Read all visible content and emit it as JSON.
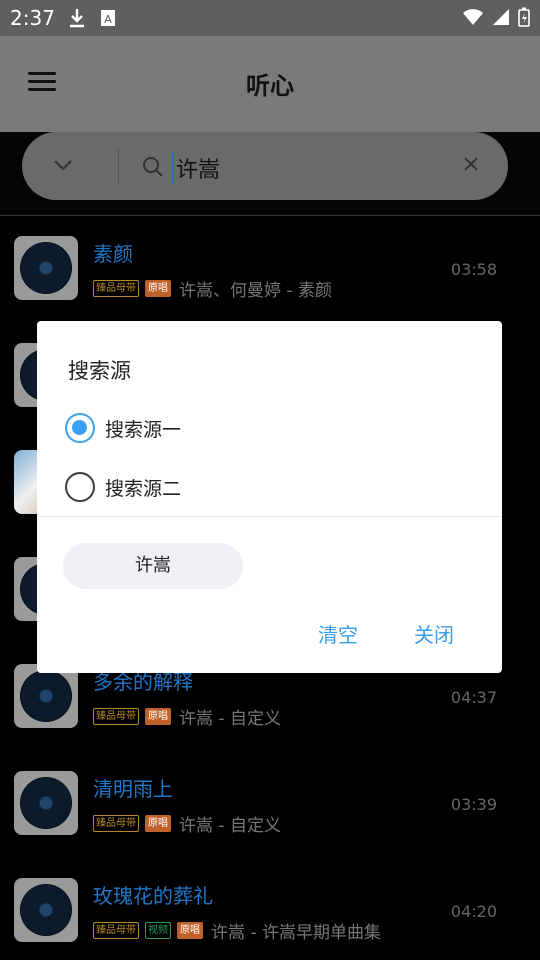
{
  "status_bar": {
    "time": "2:37"
  },
  "app_bar": {
    "title": "听心"
  },
  "search": {
    "query": "许嵩"
  },
  "songs": [
    {
      "title": "素颜",
      "tags": [
        "臻品母带",
        "原唱"
      ],
      "artist": "许嵩、何曼婷 - 素颜",
      "duration": "03:58"
    },
    {
      "title": "",
      "tags": [],
      "artist": "",
      "duration": ""
    },
    {
      "title": "",
      "tags": [],
      "artist": "",
      "duration": ""
    },
    {
      "title": "",
      "tags": [],
      "artist": "",
      "duration": ""
    },
    {
      "title": "多余的解释",
      "tags": [
        "臻品母带",
        "原唱"
      ],
      "artist": "许嵩 - 自定义",
      "duration": "04:37"
    },
    {
      "title": "清明雨上",
      "tags": [
        "臻品母带",
        "原唱"
      ],
      "artist": "许嵩 - 自定义",
      "duration": "03:39"
    },
    {
      "title": "玫瑰花的葬礼",
      "tags": [
        "臻品母带",
        "视频",
        "原唱"
      ],
      "artist": "许嵩 - 许嵩早期单曲集",
      "duration": "04:20"
    }
  ],
  "dialog": {
    "title": "搜索源",
    "options": [
      {
        "label": "搜索源一",
        "selected": true
      },
      {
        "label": "搜索源二",
        "selected": false
      }
    ],
    "history_chip": "许嵩",
    "clear_label": "清空",
    "close_label": "关闭"
  },
  "colors": {
    "accent": "#3aa0f0",
    "song_title": "#1d77c9"
  }
}
